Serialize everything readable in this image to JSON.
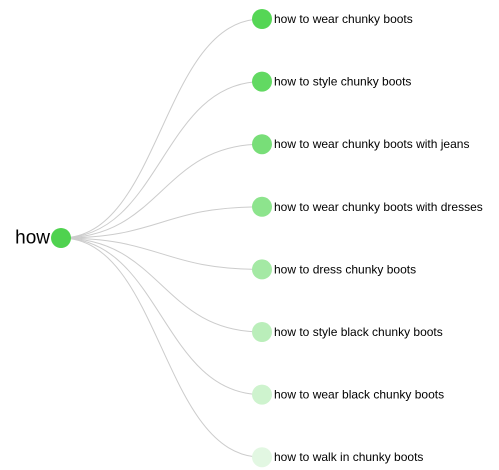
{
  "root": {
    "label": "how",
    "color": "#4fd24f"
  },
  "suggestions": [
    {
      "label": "how to wear chunky boots",
      "color": "#55d655"
    },
    {
      "label": "how to style chunky boots",
      "color": "#62d962"
    },
    {
      "label": "how to wear chunky boots with jeans",
      "color": "#78de78"
    },
    {
      "label": "how to wear chunky boots with dresses",
      "color": "#8de48d"
    },
    {
      "label": "how to dress chunky boots",
      "color": "#a4e9a4"
    },
    {
      "label": "how to style black chunky boots",
      "color": "#baeeba"
    },
    {
      "label": "how to wear black chunky boots",
      "color": "#cef3ce"
    },
    {
      "label": "how to walk in chunky boots",
      "color": "#e2f7e2"
    }
  ],
  "link_color": "#cccccc"
}
